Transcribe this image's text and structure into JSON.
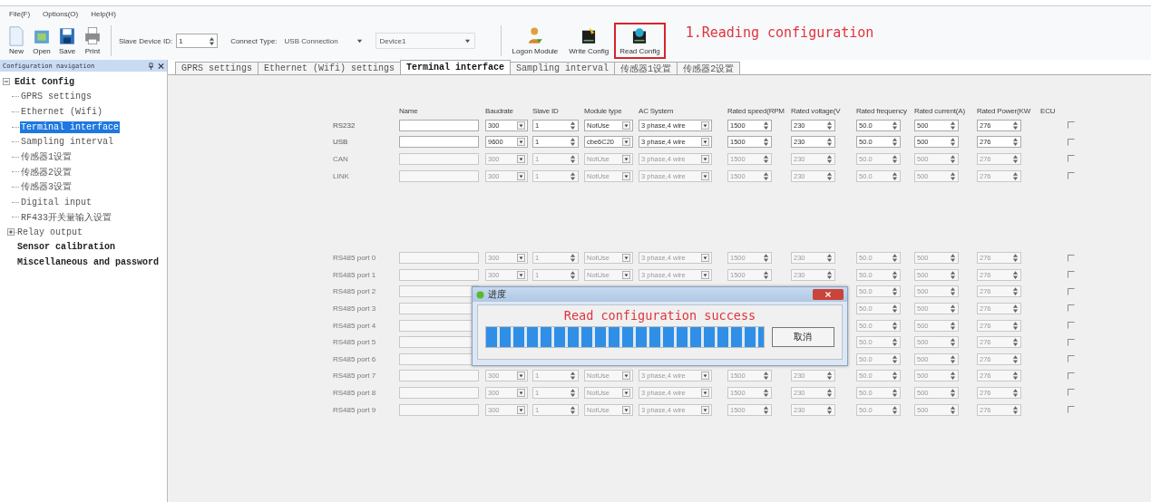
{
  "menu": [
    {
      "label": "File(F)"
    },
    {
      "label": "Options(O)"
    },
    {
      "label": "Help(H)"
    }
  ],
  "toolbar": {
    "file_buttons": [
      {
        "label": "New",
        "kind": "new"
      },
      {
        "label": "Open",
        "kind": "open"
      },
      {
        "label": "Save",
        "kind": "save"
      },
      {
        "label": "Print",
        "kind": "print"
      }
    ],
    "slave_id": {
      "label": "Slave Device ID:",
      "value": "1"
    },
    "connect_type": {
      "label": "Connect Type:",
      "value": "USB Connection"
    },
    "device": {
      "value": "Device1"
    },
    "actions": [
      {
        "label": "Logon Module",
        "kind": "logon",
        "highlighted": false
      },
      {
        "label": "Write Config",
        "kind": "write",
        "highlighted": false
      },
      {
        "label": "Read Config",
        "kind": "read",
        "highlighted": true
      }
    ],
    "annotation": "1.Reading configuration"
  },
  "sidebar": {
    "title": "Configuration navigation",
    "items": [
      {
        "label": "Edit Config",
        "expanded": true,
        "selected": false,
        "children": [
          {
            "label": "GPRS settings",
            "selected": false
          },
          {
            "label": "Ethernet (Wifi)",
            "selected": false
          },
          {
            "label": "Terminal interface",
            "selected": true
          },
          {
            "label": "Sampling interval",
            "selected": false
          },
          {
            "label": "传感器1设置",
            "selected": false
          },
          {
            "label": "传感器2设置",
            "selected": false
          },
          {
            "label": "传感器3设置",
            "selected": false
          },
          {
            "label": "Digital input",
            "selected": false
          },
          {
            "label": "RF433开关量输入设置",
            "selected": false
          },
          {
            "label": "Relay output",
            "expanded": false,
            "selected": false
          }
        ]
      },
      {
        "label": "Sensor calibration",
        "selected": false
      },
      {
        "label": "Miscellaneous and password",
        "selected": false
      }
    ]
  },
  "tabs": [
    {
      "label": "GPRS settings",
      "selected": false
    },
    {
      "label": "Ethernet (Wifi) settings",
      "selected": false
    },
    {
      "label": "Terminal interface",
      "selected": true
    },
    {
      "label": "Sampling interval",
      "selected": false
    },
    {
      "label": "传感器1设置",
      "selected": false
    },
    {
      "label": "传感器2设置",
      "selected": false
    }
  ],
  "table": {
    "columns": [
      "Name",
      "Baudrate",
      "Slave ID",
      "Module type",
      "AC System",
      "Rated speed(RPM",
      "Rated voltage(V",
      "Rated frequency",
      "Rated current(A)",
      "Rated Power(KW",
      "ECU"
    ],
    "groups": [
      {
        "rows": [
          {
            "label": "RS232",
            "disabled": false,
            "ecu": false,
            "cells": [
              "300",
              "1",
              "NotUse",
              "3 phase,4 wire",
              "1500",
              "230",
              "50.0",
              "500",
              "276"
            ]
          },
          {
            "label": "USB",
            "disabled": false,
            "ecu": false,
            "cells": [
              "9600",
              "1",
              "cbe6C20",
              "3 phase,4 wire",
              "1500",
              "230",
              "50.0",
              "500",
              "276"
            ]
          },
          {
            "label": "CAN",
            "disabled": true,
            "ecu": false,
            "cells": [
              "300",
              "1",
              "NotUse",
              "3 phase,4 wire",
              "1500",
              "230",
              "50.0",
              "500",
              "276"
            ]
          },
          {
            "label": "LINK",
            "disabled": true,
            "ecu": false,
            "cells": [
              "300",
              "1",
              "NotUse",
              "3 phase,4 wire",
              "1500",
              "230",
              "50.0",
              "500",
              "276"
            ]
          }
        ]
      },
      {
        "rows": [
          {
            "label": "RS485 port 0",
            "disabled": true,
            "ecu": false,
            "cells": [
              "300",
              "1",
              "NotUse",
              "3 phase,4 wire",
              "1500",
              "230",
              "50.0",
              "500",
              "276"
            ]
          },
          {
            "label": "RS485 port 1",
            "disabled": true,
            "ecu": false,
            "cells": [
              "300",
              "1",
              "NotUse",
              "3 phase,4 wire",
              "1500",
              "230",
              "50.0",
              "500",
              "276"
            ]
          },
          {
            "label": "RS485 port 2",
            "disabled": true,
            "ecu": false,
            "cells": [
              null,
              null,
              null,
              null,
              null,
              null,
              "50.0",
              "500",
              "276"
            ]
          },
          {
            "label": "RS485 port 3",
            "disabled": true,
            "ecu": false,
            "cells": [
              null,
              null,
              null,
              null,
              null,
              null,
              "50.0",
              "500",
              "276"
            ]
          },
          {
            "label": "RS485 port 4",
            "disabled": true,
            "ecu": false,
            "cells": [
              null,
              null,
              null,
              null,
              null,
              null,
              "50.0",
              "500",
              "276"
            ]
          },
          {
            "label": "RS485 port 5",
            "disabled": true,
            "ecu": false,
            "cells": [
              null,
              null,
              null,
              null,
              null,
              null,
              "50.0",
              "500",
              "276"
            ]
          },
          {
            "label": "RS485 port 6",
            "disabled": true,
            "ecu": false,
            "cells": [
              null,
              null,
              null,
              null,
              null,
              null,
              "50.0",
              "500",
              "276"
            ]
          },
          {
            "label": "RS485 port 7",
            "disabled": true,
            "ecu": false,
            "cells": [
              "300",
              "1",
              "NotUse",
              "3 phase,4 wire",
              "1500",
              "230",
              "50.0",
              "500",
              "276"
            ]
          },
          {
            "label": "RS485 port 8",
            "disabled": true,
            "ecu": false,
            "cells": [
              "300",
              "1",
              "NotUse",
              "3 phase,4 wire",
              "1500",
              "230",
              "50.0",
              "500",
              "276"
            ]
          },
          {
            "label": "RS485 port 9",
            "disabled": true,
            "ecu": false,
            "cells": [
              "300",
              "1",
              "NotUse",
              "3 phase,4 wire",
              "1500",
              "230",
              "50.0",
              "500",
              "276"
            ]
          }
        ]
      }
    ]
  },
  "dialog": {
    "title": "进度",
    "message": "Read configuration success",
    "progress": {
      "level": 1
    },
    "button": "取消"
  }
}
